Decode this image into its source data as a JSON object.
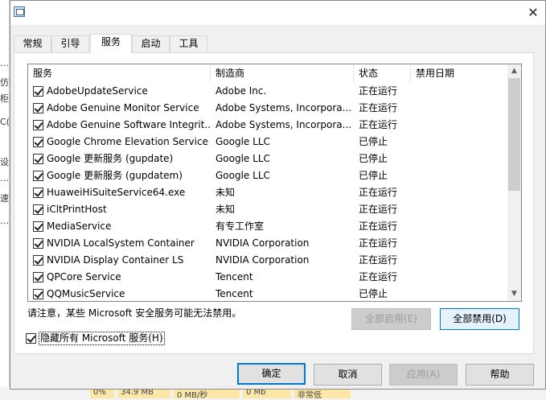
{
  "tabs": [
    "常规",
    "引导",
    "服务",
    "启动",
    "工具"
  ],
  "columns": {
    "name": "服务",
    "manufacturer": "制造商",
    "status": "状态",
    "disabled_date": "禁用日期"
  },
  "services": [
    {
      "name": "AdobeUpdateService",
      "manufacturer": "Adobe Inc.",
      "status": "正在运行",
      "checked": true
    },
    {
      "name": "Adobe Genuine Monitor Service",
      "manufacturer": "Adobe Systems, Incorpora...",
      "status": "正在运行",
      "checked": true
    },
    {
      "name": "Adobe Genuine Software Integrit...",
      "manufacturer": "Adobe Systems, Incorpora...",
      "status": "正在运行",
      "checked": true
    },
    {
      "name": "Google Chrome Elevation Service",
      "manufacturer": "Google LLC",
      "status": "已停止",
      "checked": true
    },
    {
      "name": "Google 更新服务 (gupdate)",
      "manufacturer": "Google LLC",
      "status": "已停止",
      "checked": true
    },
    {
      "name": "Google 更新服务 (gupdatem)",
      "manufacturer": "Google LLC",
      "status": "已停止",
      "checked": true
    },
    {
      "name": "HuaweiHiSuiteService64.exe",
      "manufacturer": "未知",
      "status": "正在运行",
      "checked": true
    },
    {
      "name": "iCltPrintHost",
      "manufacturer": "未知",
      "status": "正在运行",
      "checked": true
    },
    {
      "name": "MediaService",
      "manufacturer": "有专工作室",
      "status": "正在运行",
      "checked": true
    },
    {
      "name": "NVIDIA LocalSystem Container",
      "manufacturer": "NVIDIA Corporation",
      "status": "正在运行",
      "checked": true
    },
    {
      "name": "NVIDIA Display Container LS",
      "manufacturer": "NVIDIA Corporation",
      "status": "正在运行",
      "checked": true
    },
    {
      "name": "QPCore Service",
      "manufacturer": "Tencent",
      "status": "正在运行",
      "checked": true
    },
    {
      "name": "QQMusicService",
      "manufacturer": "Tencent",
      "status": "已停止",
      "checked": true
    }
  ],
  "note": "请注意，某些 Microsoft 安全服务可能无法禁用。",
  "buttons": {
    "enable_all": "全部启用(E)",
    "disable_all": "全部禁用(D)",
    "ok": "确定",
    "cancel": "取消",
    "apply": "应用(A)",
    "help": "帮助"
  },
  "hide_ms": {
    "label": "隐藏所有 Microsoft 服务(H)",
    "checked": true
  },
  "icons": {
    "close": "close-icon",
    "app": "msconfig-icon"
  },
  "background": {
    "left_chars": [
      "…",
      "仿",
      "柜",
      "C(",
      "设",
      "……",
      "速",
      "…"
    ],
    "bottom_cells": [
      "0%",
      "34.9 MB",
      "0 MB/秒",
      "0 Mb",
      "非常低"
    ]
  }
}
